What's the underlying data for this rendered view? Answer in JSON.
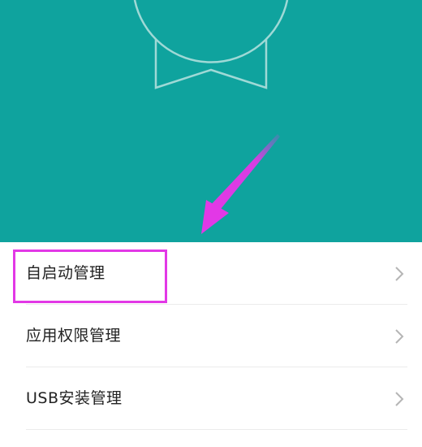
{
  "screen": {
    "header_color": "#0fa39e",
    "highlight_color": "#e238e6",
    "header_icon": "ribbon-badge-icon"
  },
  "list": {
    "items": [
      {
        "label": "自启动管理",
        "icon": "chevron-right-icon"
      },
      {
        "label": "应用权限管理",
        "icon": "chevron-right-icon"
      },
      {
        "label": "USB安装管理",
        "icon": "chevron-right-icon"
      }
    ]
  },
  "annotation": {
    "arrow_icon": "pointer-arrow-icon",
    "box": "highlight-box"
  }
}
